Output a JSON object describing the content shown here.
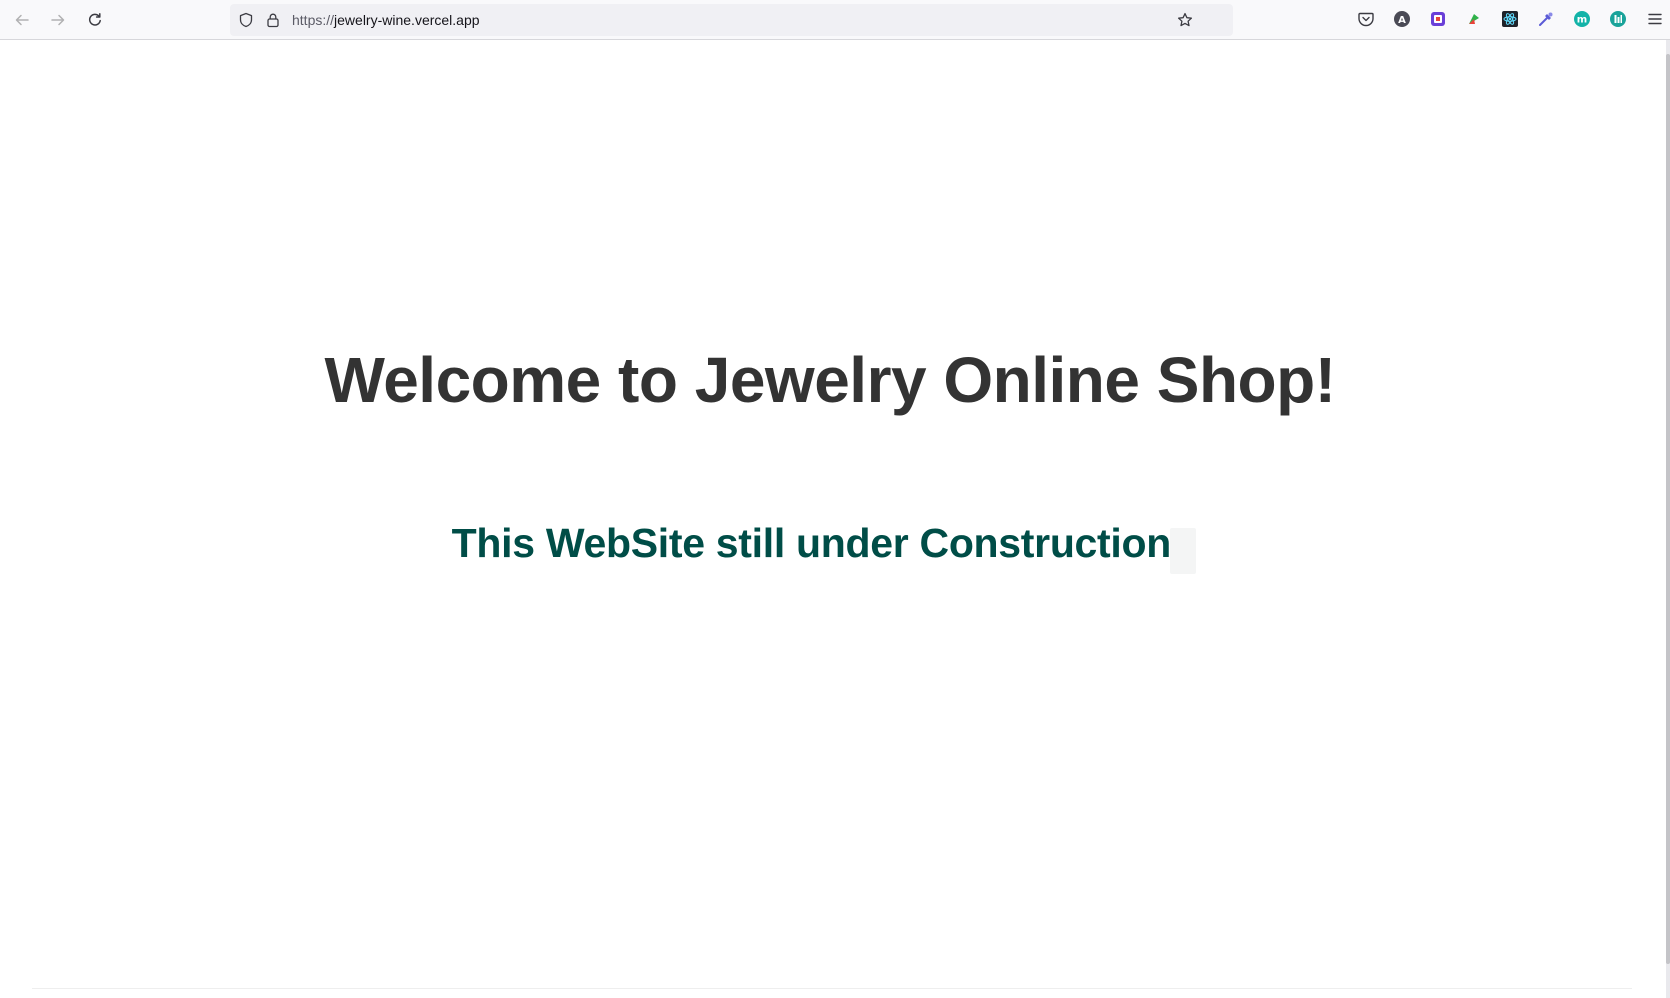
{
  "browser": {
    "url_scheme": "https://",
    "url_host": "jewelry-wine.vercel.app",
    "icons": {
      "back": "arrow-left-icon",
      "forward": "arrow-right-icon",
      "reload": "reload-icon",
      "tracking": "shield-icon",
      "lock": "lock-icon",
      "bookmark": "star-icon",
      "pocket": "pocket-icon",
      "menu": "hamburger-menu-icon"
    },
    "extensions": [
      {
        "name": "a-extension-icon",
        "glyph": "A",
        "color": "#4a4a55"
      },
      {
        "name": "grammar-extension-icon",
        "glyph": "",
        "color": "#6a3fd8"
      },
      {
        "name": "tag-extension-icon",
        "glyph": "",
        "color": "#2fb34a"
      },
      {
        "name": "react-devtools-icon",
        "glyph": "",
        "color": "#61dafb"
      },
      {
        "name": "eyedropper-extension-icon",
        "glyph": "",
        "color": "#5b5bd6"
      },
      {
        "name": "m-extension-icon",
        "glyph": "m",
        "color": "#13b3a8"
      },
      {
        "name": "shield-extension-icon",
        "glyph": "",
        "color": "#1aa39a"
      }
    ]
  },
  "page": {
    "heading": "Welcome to Jewelry Online Shop!",
    "subheading": "This WebSite still under Construction!",
    "heading_color": "#333333",
    "subheading_color": "#004d47"
  }
}
